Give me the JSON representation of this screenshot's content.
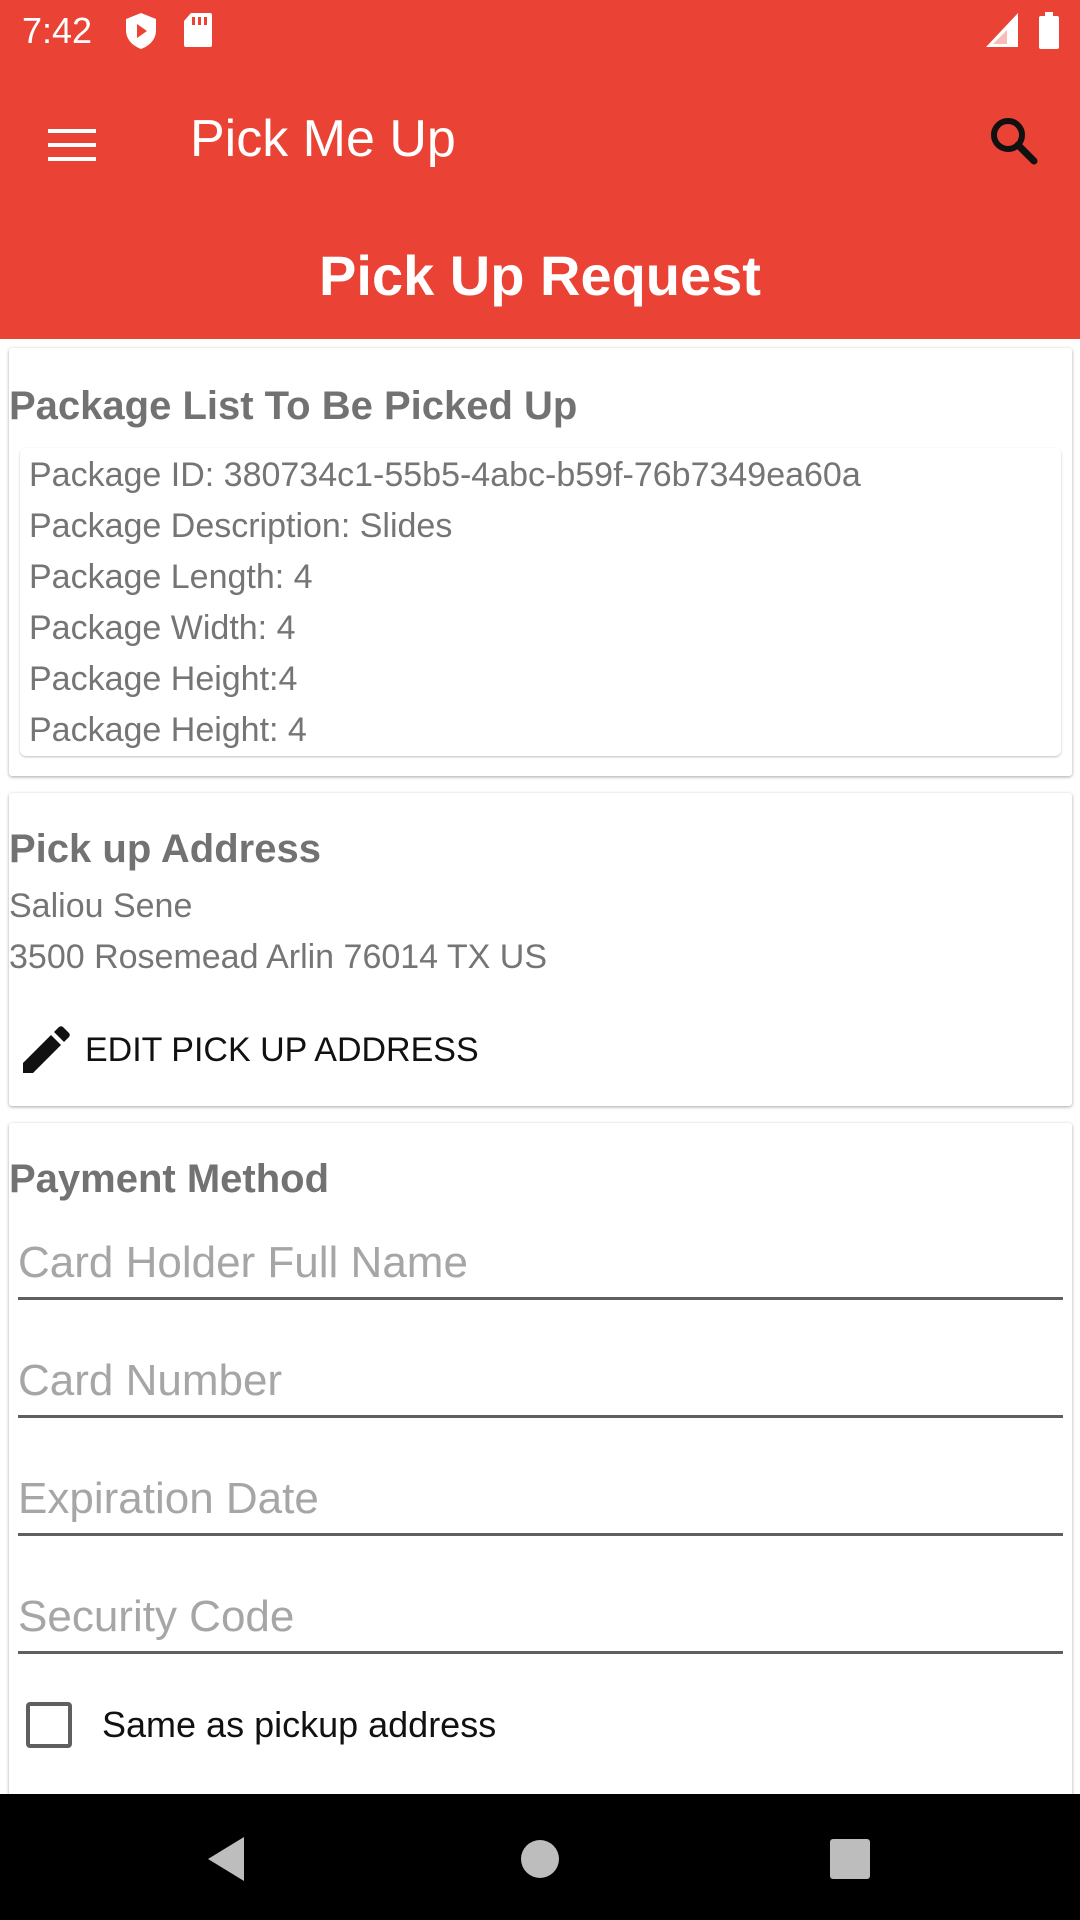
{
  "status_bar": {
    "time": "7:42",
    "icons": [
      "shield-play-icon",
      "sd-card-icon",
      "signal-icon",
      "battery-icon"
    ]
  },
  "app_bar": {
    "title": "Pick Me Up",
    "menu_icon": "menu-icon",
    "search_icon": "search-icon",
    "page_heading": "Pick Up Request",
    "accent_color": "#ea4335"
  },
  "package_card": {
    "title": "Package List To Be Picked Up",
    "lines": [
      "Package ID: 380734c1-55b5-4abc-b59f-76b7349ea60a",
      "Package Description: Slides",
      "Package Length: 4",
      "Package Width: 4",
      "Package Height:4",
      "Package Height: 4"
    ]
  },
  "address_card": {
    "title": "Pick up Address",
    "name": "Saliou Sene",
    "address": "3500 Rosemead Arlin 76014 TX US",
    "edit_label": "EDIT PICK UP ADDRESS",
    "edit_icon": "pencil-icon"
  },
  "payment_card": {
    "title": "Payment Method",
    "fields": {
      "card_holder": {
        "placeholder": "Card Holder Full Name",
        "value": ""
      },
      "card_number": {
        "placeholder": "Card Number",
        "value": ""
      },
      "expiration": {
        "placeholder": "Expiration Date",
        "value": ""
      },
      "security_code": {
        "placeholder": "Security Code",
        "value": ""
      }
    },
    "checkbox_label": "Same as pickup address",
    "checkbox_checked": false
  },
  "nav_bar": {
    "icons": [
      "back-icon",
      "home-icon",
      "recents-icon"
    ]
  }
}
